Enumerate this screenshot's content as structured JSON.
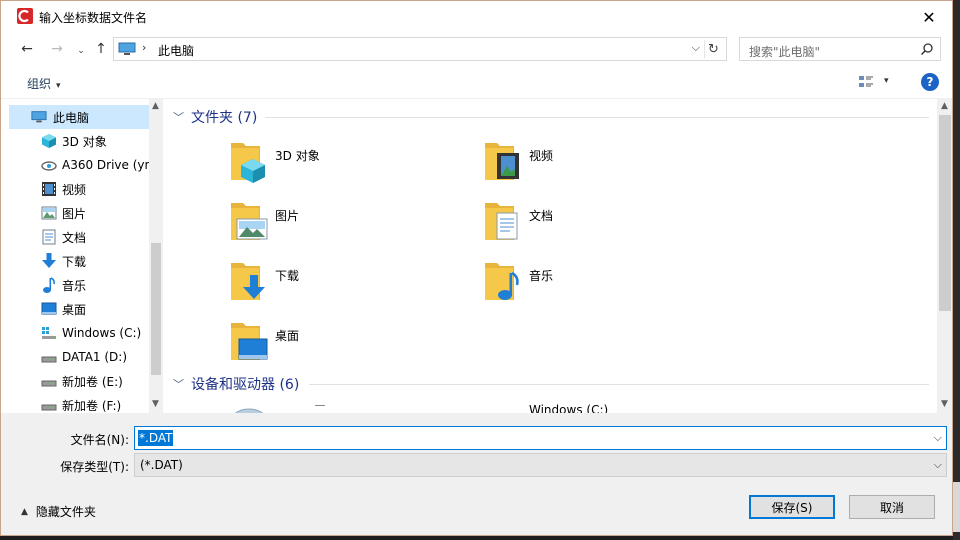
{
  "window": {
    "title": "输入坐标数据文件名",
    "close_symbol": "✕"
  },
  "nav": {
    "back_symbol": "←",
    "forward_symbol": "→",
    "history_symbol": "⌄",
    "up_symbol": "↑",
    "address_separator": "›",
    "address_path": "此电脑",
    "address_dropdown_symbol": "⌵",
    "refresh_symbol": "↻",
    "search_placeholder": "搜索\"此电脑\""
  },
  "toolbar": {
    "organize_label": "组织",
    "caret_symbol": "▾",
    "help_label": "?"
  },
  "sidebar": {
    "items": [
      {
        "label": "此电脑",
        "icon": "computer-icon",
        "selected": true
      },
      {
        "label": "3D 对象",
        "icon": "3d-objects-icon"
      },
      {
        "label": "A360 Drive (yn",
        "icon": "cloud-drive-icon"
      },
      {
        "label": "视频",
        "icon": "video-icon"
      },
      {
        "label": "图片",
        "icon": "picture-icon"
      },
      {
        "label": "文档",
        "icon": "document-icon"
      },
      {
        "label": "下载",
        "icon": "download-icon"
      },
      {
        "label": "音乐",
        "icon": "music-icon"
      },
      {
        "label": "桌面",
        "icon": "desktop-icon"
      },
      {
        "label": "Windows (C:)",
        "icon": "windows-drive-icon"
      },
      {
        "label": "DATA1 (D:)",
        "icon": "drive-icon"
      },
      {
        "label": "新加卷 (E:)",
        "icon": "drive-icon"
      },
      {
        "label": "新加卷 (F:)",
        "icon": "drive-icon"
      }
    ],
    "scroll_up_symbol": "▲",
    "scroll_down_symbol": "▼"
  },
  "content": {
    "folders_group": {
      "chevron_symbol": "﹀",
      "label": "文件夹 (7)"
    },
    "folders": [
      {
        "label": "3D 对象",
        "icon": "3d-objects-folder-icon"
      },
      {
        "label": "视频",
        "icon": "video-folder-icon"
      },
      {
        "label": "图片",
        "icon": "picture-folder-icon"
      },
      {
        "label": "文档",
        "icon": "document-folder-icon"
      },
      {
        "label": "下载",
        "icon": "download-folder-icon"
      },
      {
        "label": "音乐",
        "icon": "music-folder-icon"
      },
      {
        "label": "桌面",
        "icon": "desktop-folder-icon"
      }
    ],
    "devices_group": {
      "chevron_symbol": "﹀",
      "label": "设备和驱动器 (6)"
    },
    "devices": [
      {
        "label": "Windows (C:)",
        "icon": "windows-drive-icon"
      }
    ]
  },
  "bottom": {
    "filename_label": "文件名(N):",
    "filename_value": "*.DAT",
    "filetype_label": "保存类型(T):",
    "filetype_value": "(*.DAT)",
    "dropdown_symbol": "⌵",
    "hide_folders_caret": "▲",
    "hide_folders_label": "隐藏文件夹",
    "save_label": "保存(S)",
    "cancel_label": "取消"
  },
  "colors": {
    "accent": "#0078d7",
    "selection": "#cce8ff",
    "group_header": "#1e3287",
    "folder_yellow": "#f6c84a"
  }
}
